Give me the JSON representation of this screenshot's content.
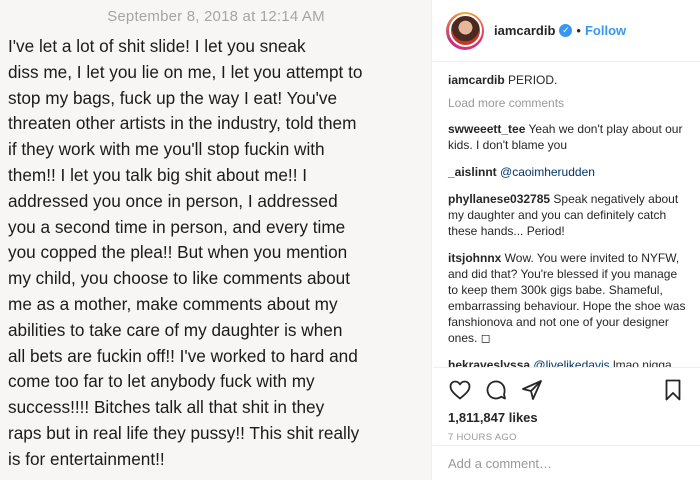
{
  "note": {
    "date": "September 8, 2018 at 12:14 AM",
    "text": "I've let a lot of shit slide! I let you sneak\ndiss me, I let you lie on me, I let you attempt to\nstop my bags, fuck up the way I eat! You've\nthreaten other artists in the industry, told them\nif they work with me you'll stop fuckin with\nthem!! I let you talk big shit about me!! I\naddressed you once in person, I addressed\nyou a second time in person, and every time\nyou copped the plea!! But when you mention\nmy child, you choose to like comments about\nme as a mother, make comments about my\nabilities to take care of my daughter is when\nall bets are fuckin off!! I've worked to hard and\ncome too far to let anybody fuck with my\nsuccess!!!! Bitches talk all that shit in they\nraps but in real life they pussy!! This shit really\nis for entertainment!!"
  },
  "post": {
    "username": "iamcardib",
    "verified_glyph": "✓",
    "dot": "•",
    "follow_label": "Follow",
    "caption_user": "iamcardib",
    "caption_text": " PERIOD.",
    "load_more": "Load more comments",
    "comments": [
      {
        "user": "swweeett_tee",
        "text": " Yeah we don't play about our kids. I don't blame you"
      },
      {
        "user": "_aislinnt",
        "mention": " @caoimherudden",
        "text": ""
      },
      {
        "user": "phyllanese032785",
        "text": " Speak negatively about my daughter and you can definitely catch these hands... Period!"
      },
      {
        "user": "itsjohnnx",
        "text": " Wow. You were invited to NYFW, and did that? You're blessed if you manage to keep them 300k gigs babe. Shameful, embarrassing behaviour. Hope the shoe was fanshionova and not one of your designer ones. ◻"
      },
      {
        "user": "hekraveslyssa",
        "mention": " @livelikedavis",
        "text": " lmao nigga shut yo ass up, Nicki been in the game way longer and guess what? she still at the top PERIOD."
      }
    ],
    "likes": "1,811,847 likes",
    "time": "7 HOURS AGO",
    "add_comment_placeholder": "Add a comment…"
  },
  "icons": [
    "heart-icon",
    "comment-icon",
    "share-icon",
    "bookmark-icon"
  ]
}
